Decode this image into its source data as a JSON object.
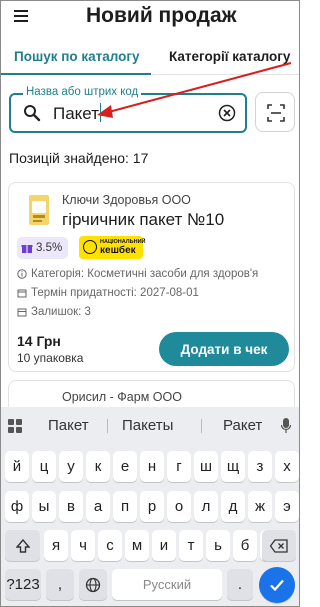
{
  "header": {
    "title": "Новий продаж",
    "menu_icon": "menu-icon"
  },
  "tabs": [
    {
      "label": "Пошук по каталогу",
      "active": true
    },
    {
      "label": "Категорії каталогу",
      "active": false
    }
  ],
  "search": {
    "label": "Назва або штрих код",
    "value": "Пакет"
  },
  "results": {
    "found_text": "Позицій знайдено: 17"
  },
  "products": [
    {
      "supplier": "Ключи Здоровья ООО",
      "name": "гірчичник пакет №10",
      "cashback": "3.5%",
      "badge": {
        "small": "НАЦІОНАЛЬНИЙ",
        "big": "кешбек"
      },
      "category": "Категорія: Косметичні засоби для здоров'я",
      "expiry": "Термін придатності: 2027-08-01",
      "stock": "Залишок: 3",
      "price": "14 Грн",
      "pack": "10 упаковка",
      "add_label": "Додати в чек"
    },
    {
      "supplier": "Орисил - Фарм ООО"
    }
  ],
  "keyboard": {
    "suggestions": [
      "Пакет",
      "Пакеты",
      "Ракет"
    ],
    "row1": [
      "й",
      "ц",
      "у",
      "к",
      "е",
      "н",
      "г",
      "ш",
      "щ",
      "з",
      "х"
    ],
    "row2": [
      "ф",
      "ы",
      "в",
      "а",
      "п",
      "р",
      "о",
      "л",
      "д",
      "ж",
      "э"
    ],
    "row3": [
      "я",
      "ч",
      "с",
      "м",
      "и",
      "т",
      "ь",
      "б",
      "ю"
    ],
    "symbols_label": "?123",
    "comma": ",",
    "space_label": "Русский",
    "period": ".",
    "colors": {
      "accent": "#1f7f8c",
      "button": "#1f8a99",
      "enter": "#1a73e8",
      "badge_yellow": "#ffe100",
      "annotation": "#d62020"
    }
  }
}
